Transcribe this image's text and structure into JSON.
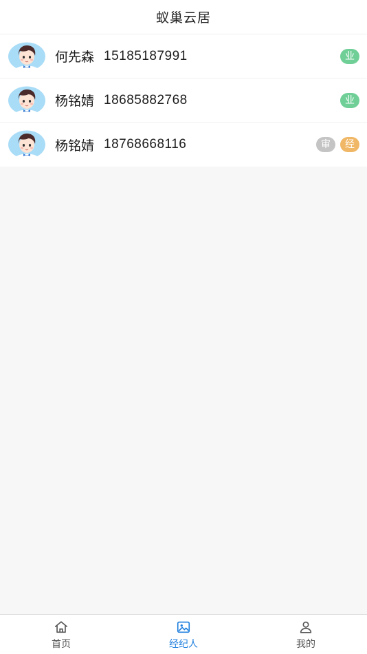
{
  "header": {
    "title": "蚁巢云居"
  },
  "list": {
    "rows": [
      {
        "name": "何先森",
        "phone": "15185187991",
        "badges": [
          {
            "label": "业",
            "color": "#6fcf97"
          }
        ]
      },
      {
        "name": "杨铭婧",
        "phone": "18685882768",
        "badges": [
          {
            "label": "业",
            "color": "#6fcf97"
          }
        ]
      },
      {
        "name": "杨铭婧",
        "phone": "18768668116",
        "badges": [
          {
            "label": "审",
            "color": "#c4c4c4"
          },
          {
            "label": "经",
            "color": "#f0b766"
          }
        ]
      }
    ],
    "avatar_icon": "boy-avatar-icon"
  },
  "tabbar": {
    "tabs": [
      {
        "label": "首页",
        "icon": "home-icon",
        "active": false
      },
      {
        "label": "经纪人",
        "icon": "image-icon",
        "active": true
      },
      {
        "label": "我的",
        "icon": "user-icon",
        "active": false
      }
    ],
    "active_color": "#1f7fde"
  }
}
